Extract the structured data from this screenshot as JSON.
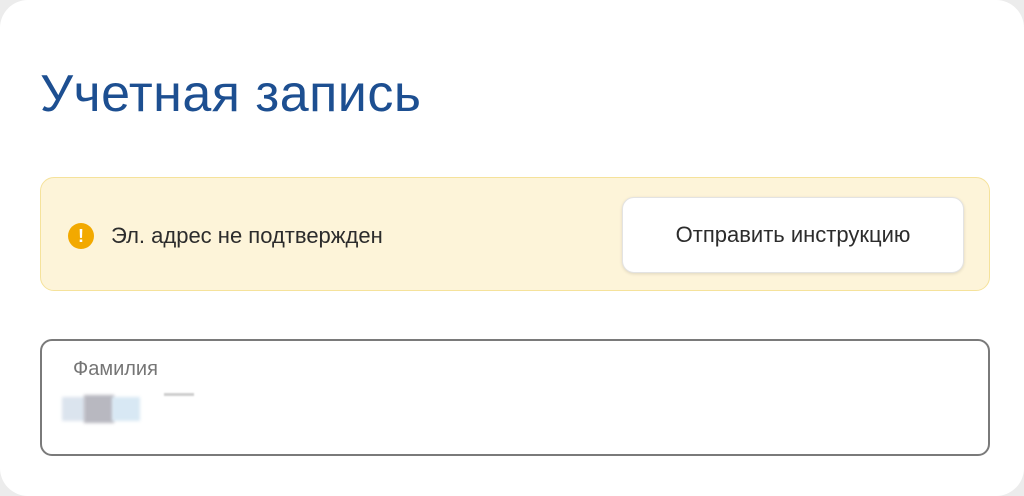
{
  "page": {
    "title": "Учетная запись"
  },
  "alert": {
    "icon": "warning-icon",
    "icon_glyph": "!",
    "message": "Эл. адрес не подтвержден",
    "button_label": "Отправить инструкцию",
    "background_color": "#fdf4d9",
    "icon_color": "#f2a900"
  },
  "form": {
    "lastname": {
      "label": "Фамилия",
      "value": ""
    }
  },
  "colors": {
    "title": "#1d4f91"
  }
}
